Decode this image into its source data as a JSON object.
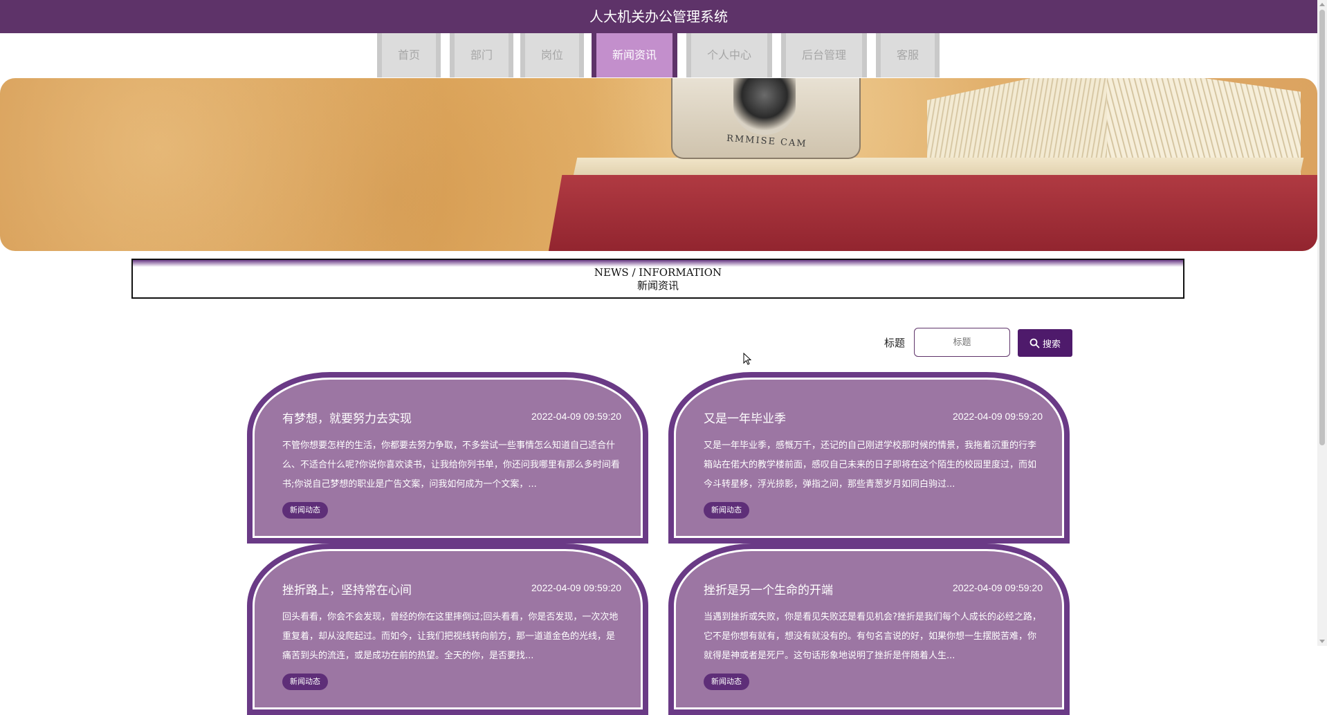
{
  "header": {
    "title": "人大机关办公管理系统"
  },
  "nav": {
    "items": [
      {
        "label": "首页"
      },
      {
        "label": "部门"
      },
      {
        "label": "岗位"
      },
      {
        "label": "新闻资讯"
      },
      {
        "label": "个人中心"
      },
      {
        "label": "后台管理"
      },
      {
        "label": "客服"
      }
    ],
    "active_index": 3
  },
  "banner": {
    "camera_text": "RMMISE CAM"
  },
  "section": {
    "title_en": "NEWS / INFORMATION",
    "title_cn": "新闻资讯"
  },
  "search": {
    "label": "标题",
    "placeholder": "标题",
    "button_label": "搜索"
  },
  "news": [
    {
      "title": "有梦想，就要努力去实现",
      "date": "2022-04-09 09:59:20",
      "summary": "不管你想要怎样的生活，你都要去努力争取，不多尝试一些事情怎么知道自己适合什么、不适合什么呢?你说你喜欢读书，让我给你列书单，你还问我哪里有那么多时间看书;你说自己梦想的职业是广告文案，问我如何成为一个文案，...",
      "tag": "新闻动态"
    },
    {
      "title": "又是一年毕业季",
      "date": "2022-04-09 09:59:20",
      "summary": "又是一年毕业季，感慨万千，还记的自己刚进学校那时候的情景，我拖着沉重的行李箱站在偌大的教学楼前面，感叹自己未来的日子即将在这个陌生的校园里度过，而如今斗转星移，浮光掠影，弹指之间，那些青葱岁月如同白驹过...",
      "tag": "新闻动态"
    },
    {
      "title": "挫折路上，坚持常在心间",
      "date": "2022-04-09 09:59:20",
      "summary": "回头看看，你会不会发现，曾经的你在这里摔倒过;回头看看，你是否发现，一次次地重复着，却从没爬起过。而如今，让我们把视线转向前方，那一道道金色的光线，是痛苦到头的流连，或是成功在前的热望。全天的你，是否要找...",
      "tag": "新闻动态"
    },
    {
      "title": "挫折是另一个生命的开端",
      "date": "2022-04-09 09:59:20",
      "summary": "当遇到挫折或失败，你是看见失败还是看见机会?挫折是我们每个人成长的必经之路，它不是你想有就有，想没有就没有的。有句名言说的好，如果你想一生摆脱苦难，你就得是神或者是死尸。这句话形象地说明了挫折是伴随着人生...",
      "tag": "新闻动态"
    }
  ]
}
